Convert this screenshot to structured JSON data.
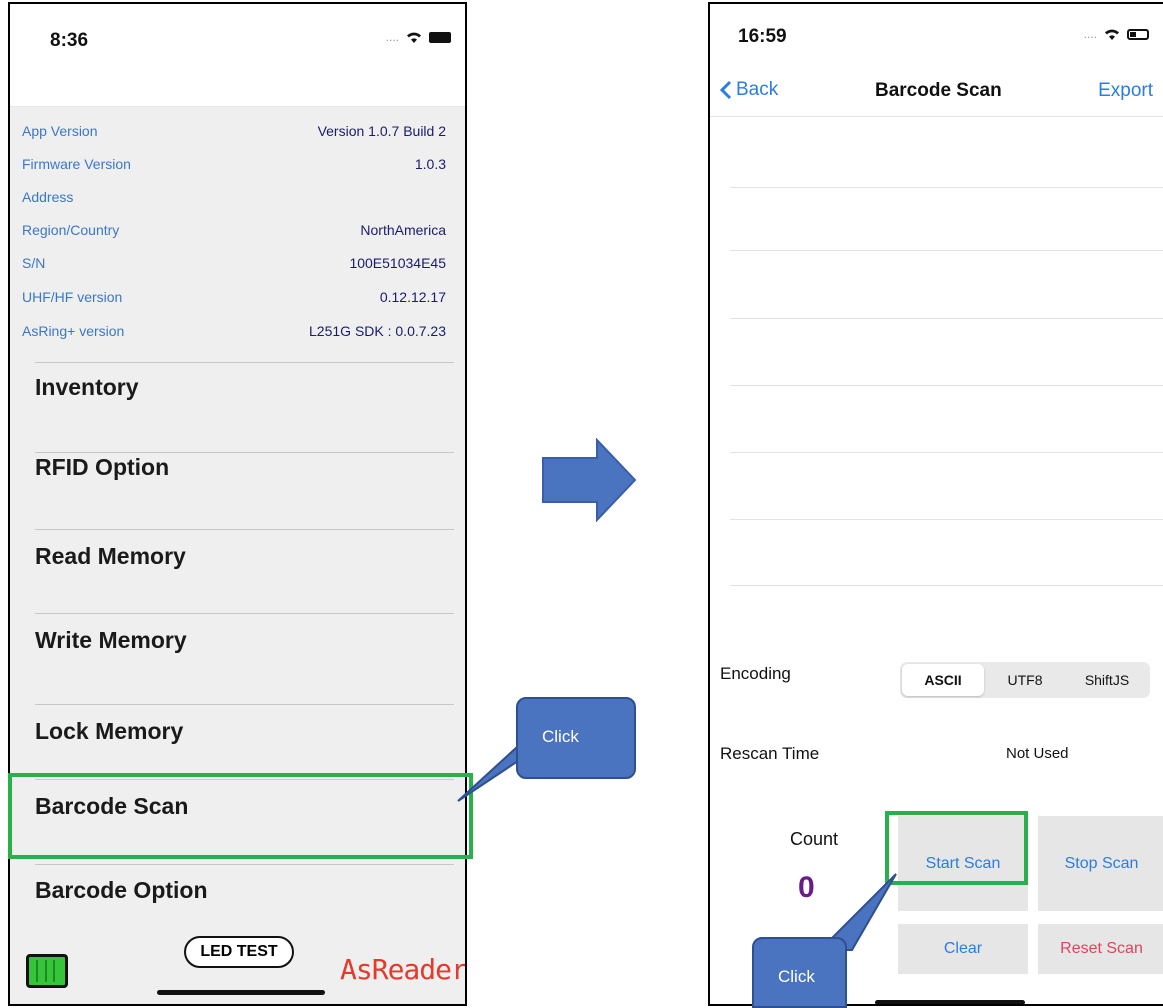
{
  "left_screen": {
    "status_time": "8:36",
    "info": [
      {
        "label": "App Version",
        "value": "Version 1.0.7 Build 2"
      },
      {
        "label": "Firmware Version",
        "value": "1.0.3"
      },
      {
        "label": "Address",
        "value": ""
      },
      {
        "label": "Region/Country",
        "value": "NorthAmerica"
      },
      {
        "label": "S/N",
        "value": "100E51034E45"
      },
      {
        "label": "UHF/HF version",
        "value": "0.12.12.17"
      },
      {
        "label": "AsRing+ version",
        "value": "L251G SDK : 0.0.7.23"
      }
    ],
    "menu": [
      {
        "label": "Inventory"
      },
      {
        "label": "RFID Option"
      },
      {
        "label": "Read Memory"
      },
      {
        "label": "Write Memory"
      },
      {
        "label": "Lock Memory"
      },
      {
        "label": "Barcode Scan"
      },
      {
        "label": "Barcode Option"
      }
    ],
    "footer": {
      "led_test": "LED TEST",
      "brand": "AsReader"
    }
  },
  "right_screen": {
    "status_time": "16:59",
    "nav": {
      "back": "Back",
      "title": "Barcode Scan",
      "export": "Export"
    },
    "encoding": {
      "label": "Encoding",
      "options": [
        "ASCII",
        "UTF8",
        "ShiftJS"
      ],
      "selected": "ASCII"
    },
    "rescan": {
      "label": "Rescan Time",
      "value": "Not Used"
    },
    "count": {
      "label": "Count",
      "value": "0"
    },
    "buttons": {
      "start": "Start Scan",
      "stop": "Stop Scan",
      "clear": "Clear",
      "reset": "Reset Scan"
    }
  },
  "callouts": {
    "left": "Click",
    "right": "Click"
  },
  "colors": {
    "accent_blue": "#2a7de1",
    "label_blue": "#3b77c8",
    "highlight_green": "#27b04b",
    "callout_blue": "#4a73c0",
    "count_purple": "#6a1b8a",
    "reset_red": "#e0445b",
    "battery_green": "#35c43a"
  }
}
